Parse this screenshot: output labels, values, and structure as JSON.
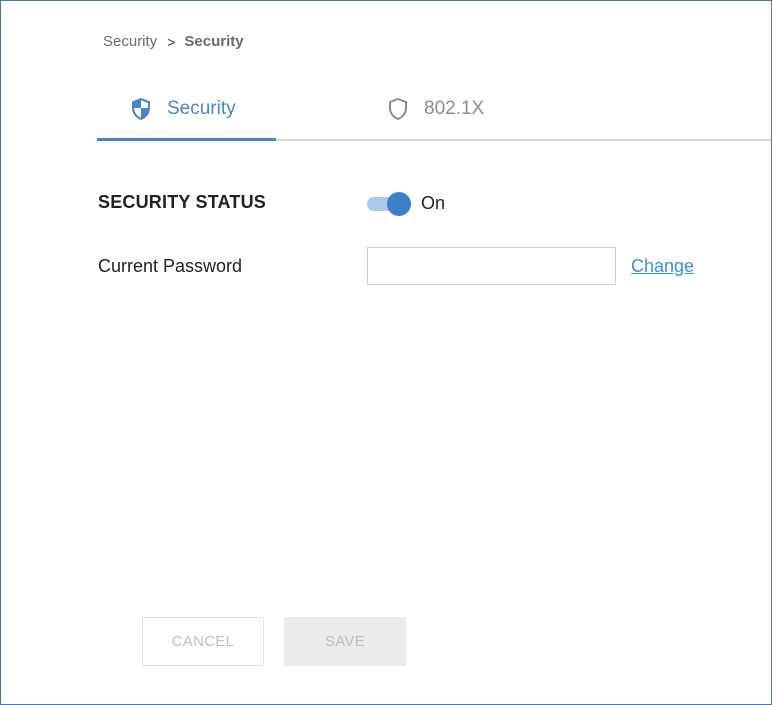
{
  "breadcrumb": {
    "parent": "Security",
    "separator": ">",
    "current": "Security"
  },
  "tabs": [
    {
      "label": "Security",
      "icon": "shield-filled-icon",
      "active": true
    },
    {
      "label": "802.1X",
      "icon": "shield-outline-icon",
      "active": false
    }
  ],
  "form": {
    "security_status_label": "SECURITY STATUS",
    "security_status_value": "On",
    "security_status_enabled": true,
    "current_password_label": "Current Password",
    "current_password_value": "",
    "change_link_label": "Change"
  },
  "actions": {
    "cancel_label": "CANCEL",
    "save_label": "SAVE"
  },
  "colors": {
    "accent": "#4a86c7",
    "toggle_knob": "#3f7fca",
    "toggle_track": "#a9c8ea",
    "link": "#3b8fd6",
    "frame_border": "#4a72b5"
  }
}
